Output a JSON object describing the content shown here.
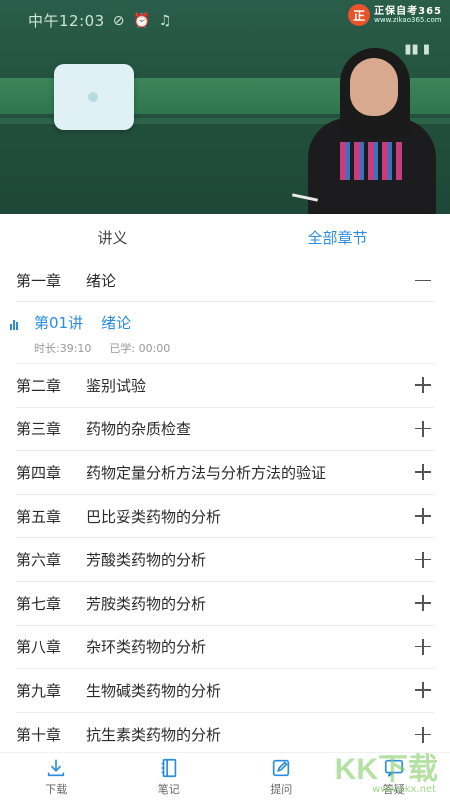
{
  "status_bar": {
    "time": "中午12:03",
    "icons": [
      "no-disturb-icon",
      "alarm-icon",
      "bell-icon"
    ]
  },
  "brand": {
    "mark": "正",
    "name": "正保自考365",
    "url": "www.zikao365.com"
  },
  "tabs": [
    {
      "label": "讲义",
      "active": false
    },
    {
      "label": "全部章节",
      "active": true
    }
  ],
  "chapters": [
    {
      "num": "第一章",
      "title": "绪论",
      "expanded": true
    },
    {
      "num": "第二章",
      "title": "鉴别试验",
      "expanded": false
    },
    {
      "num": "第三章",
      "title": "药物的杂质检查",
      "expanded": false
    },
    {
      "num": "第四章",
      "title": "药物定量分析方法与分析方法的验证",
      "expanded": false
    },
    {
      "num": "第五章",
      "title": "巴比妥类药物的分析",
      "expanded": false
    },
    {
      "num": "第六章",
      "title": "芳酸类药物的分析",
      "expanded": false
    },
    {
      "num": "第七章",
      "title": "芳胺类药物的分析",
      "expanded": false
    },
    {
      "num": "第八章",
      "title": "杂环类药物的分析",
      "expanded": false
    },
    {
      "num": "第九章",
      "title": "生物碱类药物的分析",
      "expanded": false
    },
    {
      "num": "第十章",
      "title": "抗生素类药物的分析",
      "expanded": false
    }
  ],
  "lesson": {
    "num": "第01讲",
    "title": "绪论",
    "duration": "时长:39:10",
    "studied": "已学: 00:00"
  },
  "bottom_bar": [
    {
      "label": "下载",
      "icon": "download-icon"
    },
    {
      "label": "笔记",
      "icon": "notebook-icon"
    },
    {
      "label": "提问",
      "icon": "edit-icon"
    },
    {
      "label": "答疑",
      "icon": "qa-icon"
    }
  ],
  "watermark": {
    "text": "KK下载",
    "url": "www.kkx.net"
  },
  "colors": {
    "accent": "#2a8ee0",
    "board": "#24533f"
  }
}
